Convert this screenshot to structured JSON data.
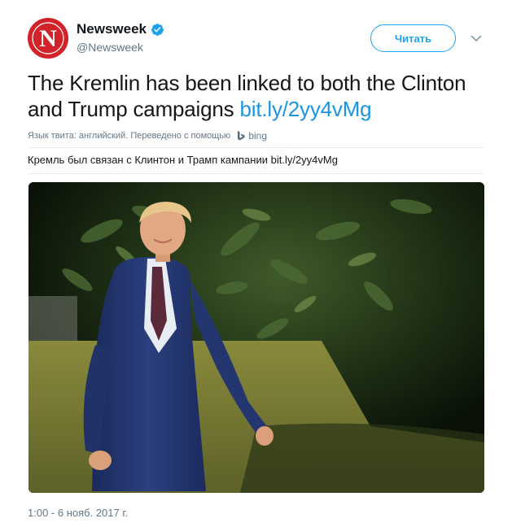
{
  "account": {
    "name": "Newsweek",
    "handle": "@Newsweek",
    "avatar_letter": "N",
    "brand_color": "#d2232a",
    "verified_icon": "verified-badge-icon"
  },
  "actions": {
    "follow_label": "Читать",
    "menu_icon": "chevron-down-icon"
  },
  "tweet": {
    "text": "The Kremlin has been linked to both the Clinton and Trump campaigns ",
    "link": "bit.ly/2yy4vMg",
    "link_color": "#1b95e0"
  },
  "translation": {
    "note": "Язык твита: английский. Переведено с помощью",
    "provider": "bing",
    "provider_icon": "bing-icon",
    "text": "Кремль был связан с Клинтон и Трамп кампании bit.ly/2yy4vMg"
  },
  "media": {
    "photo_icon": "photo-image"
  },
  "timestamp": "1:00 - 6 нояб. 2017 г."
}
